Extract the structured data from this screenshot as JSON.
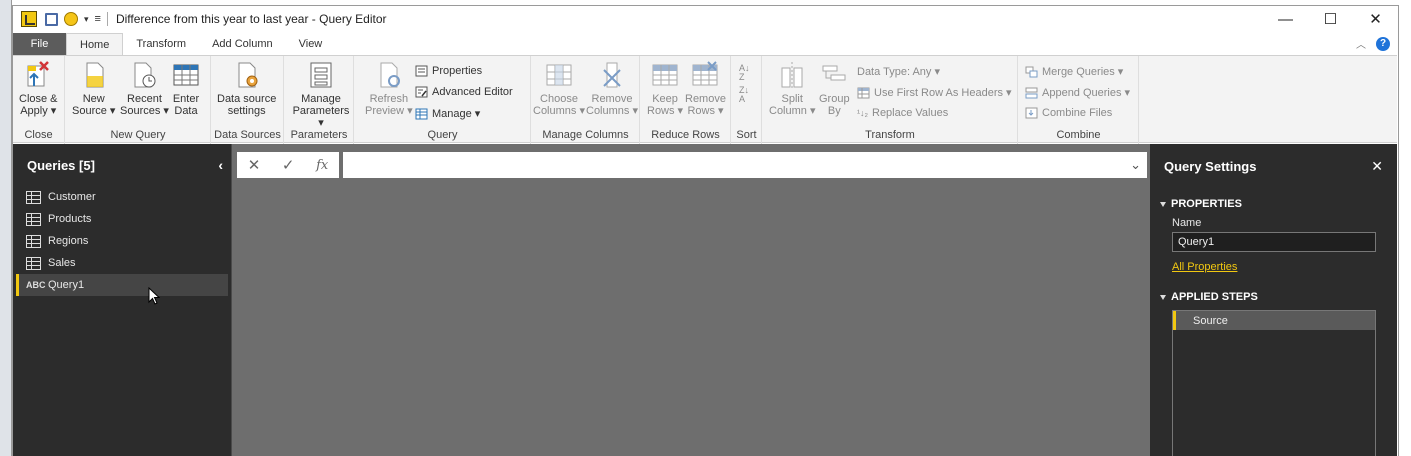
{
  "window": {
    "title": "Difference from this year to last year - Query Editor",
    "controls": {
      "minimize": "—",
      "maximize": "☐",
      "close": "✕"
    }
  },
  "tabs": [
    {
      "label": "File"
    },
    {
      "label": "Home"
    },
    {
      "label": "Transform"
    },
    {
      "label": "Add Column"
    },
    {
      "label": "View"
    }
  ],
  "ribbon": {
    "groups": {
      "close": "Close",
      "new_query": "New Query",
      "data_sources": "Data Sources",
      "parameters": "Parameters",
      "query": "Query",
      "manage_columns": "Manage Columns",
      "reduce_rows": "Reduce Rows",
      "sort": "Sort",
      "transform": "Transform",
      "combine": "Combine"
    },
    "buttons": {
      "close_apply": [
        "Close &",
        "Apply ▾"
      ],
      "new_source": [
        "New",
        "Source ▾"
      ],
      "recent_sources": [
        "Recent",
        "Sources ▾"
      ],
      "enter_data": [
        "Enter",
        "Data"
      ],
      "data_source_settings": [
        "Data source",
        "settings"
      ],
      "manage_parameters": [
        "Manage",
        "Parameters ▾"
      ],
      "refresh_preview": [
        "Refresh",
        "Preview ▾"
      ],
      "properties": "Properties",
      "advanced_editor": "Advanced Editor",
      "manage": "Manage ▾",
      "choose_columns": [
        "Choose",
        "Columns ▾"
      ],
      "remove_columns": [
        "Remove",
        "Columns ▾"
      ],
      "keep_rows": [
        "Keep",
        "Rows ▾"
      ],
      "remove_rows": [
        "Remove",
        "Rows ▾"
      ],
      "split_column": [
        "Split",
        "Column ▾"
      ],
      "group_by": [
        "Group",
        "By"
      ],
      "data_type": "Data Type: Any ▾",
      "use_first_row": "Use First Row As Headers ▾",
      "replace_values": "Replace Values",
      "merge_queries": "Merge Queries ▾",
      "append_queries": "Append Queries ▾",
      "combine_files": "Combine Files"
    }
  },
  "queries": {
    "header": "Queries [5]",
    "items": [
      {
        "label": "Customer",
        "icon": "table-icon"
      },
      {
        "label": "Products",
        "icon": "table-icon"
      },
      {
        "label": "Regions",
        "icon": "table-icon"
      },
      {
        "label": "Sales",
        "icon": "table-icon"
      },
      {
        "label": "Query1",
        "icon": "abc-icon",
        "abc": "ABC"
      }
    ]
  },
  "formula_bar": {
    "cancel": "✕",
    "commit": "✓",
    "fx": "fx",
    "value": "",
    "expand": "⌄"
  },
  "settings": {
    "header": "Query Settings",
    "properties_title": "PROPERTIES",
    "name_label": "Name",
    "name_value": "Query1",
    "all_properties": "All Properties",
    "applied_steps_title": "APPLIED STEPS",
    "steps": [
      "Source"
    ]
  },
  "colors": {
    "accent": "#f2c811",
    "pane_bg": "#2c2c2c",
    "canvas_bg": "#6e6e6e",
    "file_tab": "#5c5c5c"
  }
}
